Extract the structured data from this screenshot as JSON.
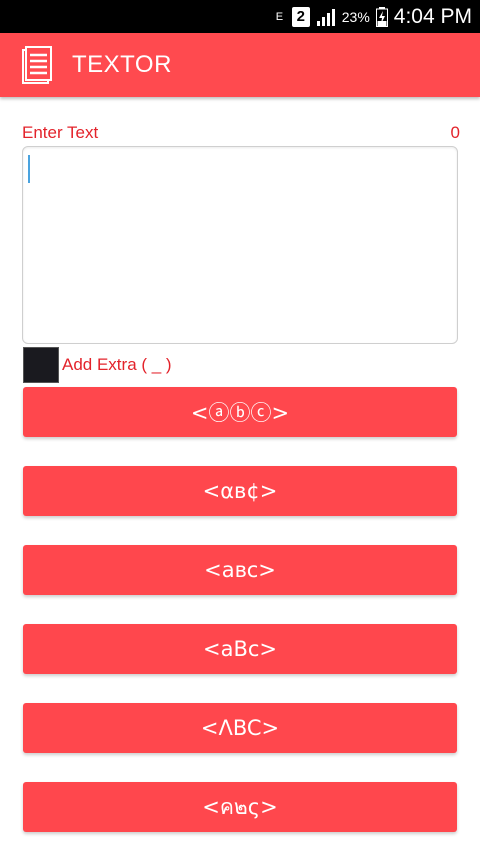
{
  "status_bar": {
    "network_letter": "E",
    "sim_slot": "2",
    "battery_percent": "23%",
    "time": "4:04 PM"
  },
  "app_bar": {
    "title": "TEXTOR",
    "icon": "document-icon",
    "background": "#ff4a4f"
  },
  "input": {
    "label": "Enter Text",
    "char_count": "0",
    "value": ""
  },
  "extra_option": {
    "label": "Add Extra ( _ )",
    "checked": false
  },
  "style_buttons": [
    {
      "label": "<ⓐⓑⓒ>"
    },
    {
      "label": "<αв¢>"
    },
    {
      "label": "<aʙᴄ>"
    },
    {
      "label": "<aBc>"
    },
    {
      "label": "<ΛBC>"
    },
    {
      "label": "<ค๒ς>"
    }
  ],
  "colors": {
    "accent": "#ff474d",
    "label_text": "#e3232b"
  }
}
